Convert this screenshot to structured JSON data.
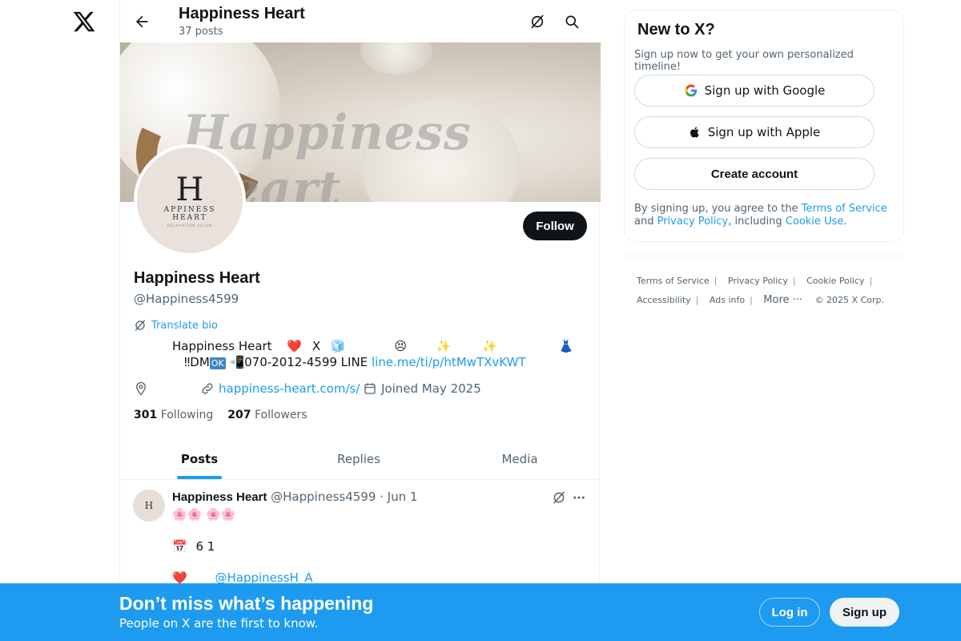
{
  "header": {
    "title": "Happiness Heart",
    "post_count": "37 posts"
  },
  "banner": {
    "watermark": "Happiness Heart"
  },
  "avatar": {
    "monogram": "H",
    "brand_line": "APPINESS",
    "brand_line2": "HEART",
    "tagline": "RELAXATION SALON"
  },
  "profile": {
    "follow_label": "Follow",
    "name": "Happiness Heart",
    "handle": "@Happiness4599",
    "translate_label": "Translate bio",
    "bio_line1": [
      "Happiness Heart",
      "❤️",
      "X",
      "🧊",
      "😣",
      "✨",
      "✨",
      "👗"
    ],
    "bio_line2_prefix": "‼DM",
    "bio_line2_badge": "OK",
    "bio_line2_phone": "📲070-2012-4599 LINE",
    "bio_link": "line.me/ti/p/htMwTXvKWT",
    "website": "happiness-heart.com/s/",
    "joined": "Joined May 2025",
    "following_count": "301",
    "following_label": "Following",
    "followers_count": "207",
    "followers_label": "Followers"
  },
  "tabs": [
    "Posts",
    "Replies",
    "Media"
  ],
  "post": {
    "author": "Happiness Heart",
    "handle_date": "@Happiness4599 · Jun 1",
    "line1": "🌸🌸              🌸🌸",
    "line2_icon": "📅",
    "line2_text": "6  1",
    "line3_icon": "❤️",
    "line3_mention": "@HappinessH_A"
  },
  "signup_card": {
    "title": "New to X?",
    "subtitle": "Sign up now to get your own personalized timeline!",
    "google_label": "Sign up with Google",
    "apple_label": "Sign up with Apple",
    "create_label": "Create account",
    "legal_prefix": "By signing up, you agree to the ",
    "terms_link": "Terms of Service",
    "legal_and": " and ",
    "privacy_link": "Privacy Policy",
    "legal_including": ", including ",
    "cookie_link": "Cookie Use",
    "legal_end": "."
  },
  "footer": {
    "links": [
      "Terms of Service",
      "Privacy Policy",
      "Cookie Policy",
      "Accessibility",
      "Ads info"
    ],
    "more_label": "More ···",
    "copyright": "© 2025 X Corp."
  },
  "bottom_bar": {
    "title": "Don’t miss what’s happening",
    "subtitle": "People on X are the first to know.",
    "login_label": "Log in",
    "signup_label": "Sign up"
  },
  "colors": {
    "accent": "#1d9bf0",
    "text": "#0f1419",
    "secondary": "#536471"
  }
}
